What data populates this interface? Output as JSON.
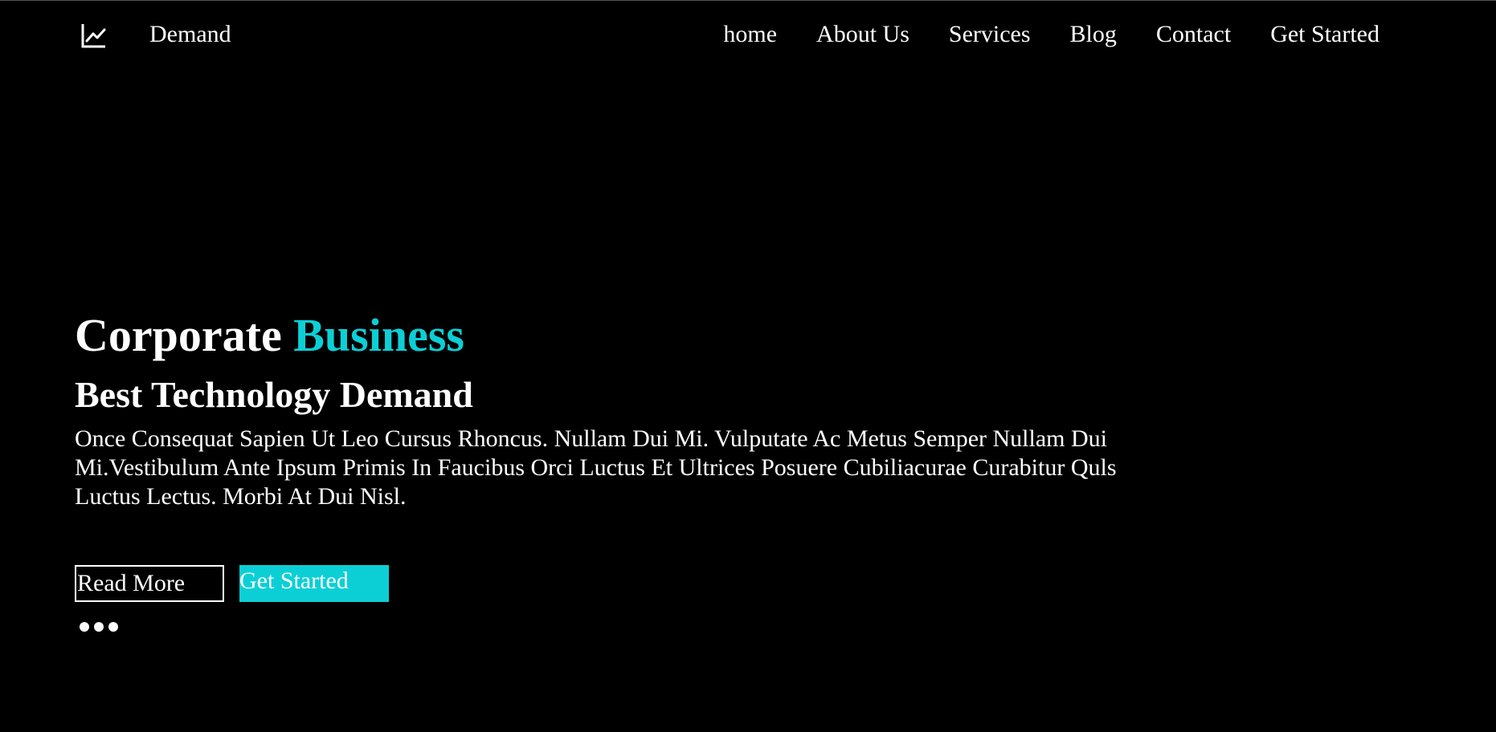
{
  "header": {
    "logo_icon": "line-chart-icon",
    "brand": "Demand",
    "nav": [
      {
        "label": "home"
      },
      {
        "label": "About Us"
      },
      {
        "label": "Services"
      },
      {
        "label": "Blog"
      },
      {
        "label": "Contact"
      },
      {
        "label": "Get Started"
      }
    ]
  },
  "hero": {
    "title_plain": "Corporate",
    "title_accent": "Business",
    "subtitle": "Best Technology Demand",
    "text": "Once Consequat Sapien Ut Leo Cursus Rhoncus. Nullam Dui Mi. Vulputate Ac Metus Semper Nullam Dui Mi.Vestibulum Ante Ipsum Primis In Faucibus Orci Luctus Et Ultrices Posuere Cubiliacurae Curabitur Quls Luctus Lectus. Morbi At Dui Nisl.",
    "read_more_label": "Read More",
    "get_started_label": "Get Started"
  },
  "slider": {
    "dot_count": 3
  },
  "colors": {
    "background": "#000000",
    "text": "#ffffff",
    "accent": "#0ccfd5"
  }
}
